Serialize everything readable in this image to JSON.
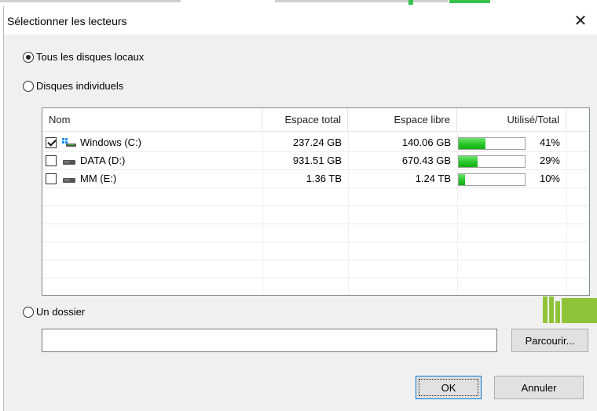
{
  "dialog": {
    "title": "Sélectionner les lecteurs",
    "close_icon": "close-icon"
  },
  "options": {
    "all_local": "Tous les disques locaux",
    "individual": "Disques individuels",
    "folder": "Un dossier",
    "selected": "all_local"
  },
  "table": {
    "columns": [
      "Nom",
      "Espace total",
      "Espace libre",
      "Utilisé/Total"
    ],
    "rows": [
      {
        "checked": true,
        "icon": "windows-drive-icon",
        "name": "Windows (C:)",
        "total": "237.24 GB",
        "free": "140.06 GB",
        "used_fraction": 0.41,
        "used_pct": "41%"
      },
      {
        "checked": false,
        "icon": "drive-icon",
        "name": "DATA (D:)",
        "total": "931.51 GB",
        "free": "670.43 GB",
        "used_fraction": 0.29,
        "used_pct": "29%"
      },
      {
        "checked": false,
        "icon": "drive-icon",
        "name": "MM (E:)",
        "total": "1.36 TB",
        "free": "1.24 TB",
        "used_fraction": 0.1,
        "used_pct": "10%"
      }
    ]
  },
  "folder_input": {
    "value": "",
    "placeholder": ""
  },
  "buttons": {
    "browse": "Parcourir...",
    "ok": "OK",
    "cancel": "Annuler"
  },
  "colors": {
    "bar_fill": "#2ec82e",
    "accent": "#0078d7"
  }
}
